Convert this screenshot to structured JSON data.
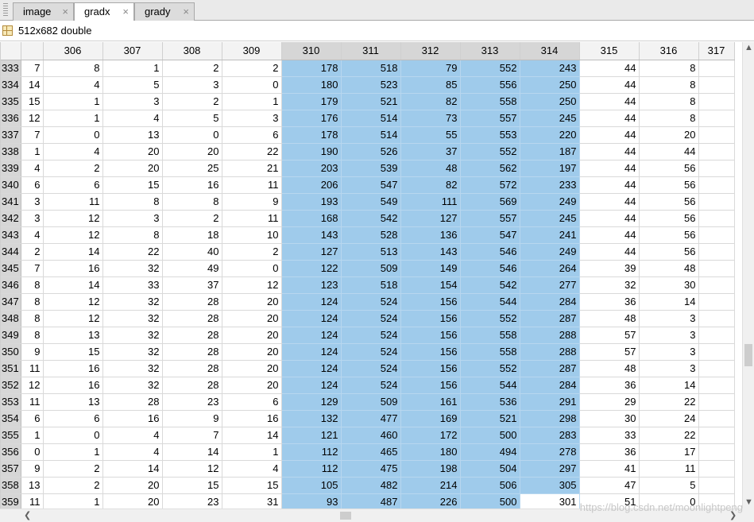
{
  "tabs": [
    {
      "label": "image",
      "active": false
    },
    {
      "label": "gradx",
      "active": true
    },
    {
      "label": "grady",
      "active": false
    }
  ],
  "variable": {
    "size_label": "512x682 double"
  },
  "grid": {
    "columns": [
      "",
      "306",
      "307",
      "308",
      "309",
      "310",
      "311",
      "312",
      "313",
      "314",
      "315",
      "316",
      "317"
    ],
    "selected_columns": [
      "310",
      "311",
      "312",
      "313",
      "314"
    ],
    "rows": [
      {
        "index": "333",
        "cells": [
          "7",
          "8",
          "1",
          "2",
          "2",
          "178",
          "518",
          "79",
          "552",
          "243",
          "44",
          "8"
        ]
      },
      {
        "index": "334",
        "cells": [
          "14",
          "4",
          "5",
          "3",
          "0",
          "180",
          "523",
          "85",
          "556",
          "250",
          "44",
          "8"
        ]
      },
      {
        "index": "335",
        "cells": [
          "15",
          "1",
          "3",
          "2",
          "1",
          "179",
          "521",
          "82",
          "558",
          "250",
          "44",
          "8"
        ]
      },
      {
        "index": "336",
        "cells": [
          "12",
          "1",
          "4",
          "5",
          "3",
          "176",
          "514",
          "73",
          "557",
          "245",
          "44",
          "8"
        ]
      },
      {
        "index": "337",
        "cells": [
          "7",
          "0",
          "13",
          "0",
          "6",
          "178",
          "514",
          "55",
          "553",
          "220",
          "44",
          "20"
        ]
      },
      {
        "index": "338",
        "cells": [
          "1",
          "4",
          "20",
          "20",
          "22",
          "190",
          "526",
          "37",
          "552",
          "187",
          "44",
          "44"
        ]
      },
      {
        "index": "339",
        "cells": [
          "4",
          "2",
          "20",
          "25",
          "21",
          "203",
          "539",
          "48",
          "562",
          "197",
          "44",
          "56"
        ]
      },
      {
        "index": "340",
        "cells": [
          "6",
          "6",
          "15",
          "16",
          "11",
          "206",
          "547",
          "82",
          "572",
          "233",
          "44",
          "56"
        ]
      },
      {
        "index": "341",
        "cells": [
          "3",
          "11",
          "8",
          "8",
          "9",
          "193",
          "549",
          "111",
          "569",
          "249",
          "44",
          "56"
        ]
      },
      {
        "index": "342",
        "cells": [
          "3",
          "12",
          "3",
          "2",
          "11",
          "168",
          "542",
          "127",
          "557",
          "245",
          "44",
          "56"
        ]
      },
      {
        "index": "343",
        "cells": [
          "4",
          "12",
          "8",
          "18",
          "10",
          "143",
          "528",
          "136",
          "547",
          "241",
          "44",
          "56"
        ]
      },
      {
        "index": "344",
        "cells": [
          "2",
          "14",
          "22",
          "40",
          "2",
          "127",
          "513",
          "143",
          "546",
          "249",
          "44",
          "56"
        ]
      },
      {
        "index": "345",
        "cells": [
          "7",
          "16",
          "32",
          "49",
          "0",
          "122",
          "509",
          "149",
          "546",
          "264",
          "39",
          "48"
        ]
      },
      {
        "index": "346",
        "cells": [
          "8",
          "14",
          "33",
          "37",
          "12",
          "123",
          "518",
          "154",
          "542",
          "277",
          "32",
          "30"
        ]
      },
      {
        "index": "347",
        "cells": [
          "8",
          "12",
          "32",
          "28",
          "20",
          "124",
          "524",
          "156",
          "544",
          "284",
          "36",
          "14"
        ]
      },
      {
        "index": "348",
        "cells": [
          "8",
          "12",
          "32",
          "28",
          "20",
          "124",
          "524",
          "156",
          "552",
          "287",
          "48",
          "3"
        ]
      },
      {
        "index": "349",
        "cells": [
          "8",
          "13",
          "32",
          "28",
          "20",
          "124",
          "524",
          "156",
          "558",
          "288",
          "57",
          "3"
        ]
      },
      {
        "index": "350",
        "cells": [
          "9",
          "15",
          "32",
          "28",
          "20",
          "124",
          "524",
          "156",
          "558",
          "288",
          "57",
          "3"
        ]
      },
      {
        "index": "351",
        "cells": [
          "11",
          "16",
          "32",
          "28",
          "20",
          "124",
          "524",
          "156",
          "552",
          "287",
          "48",
          "3"
        ]
      },
      {
        "index": "352",
        "cells": [
          "12",
          "16",
          "32",
          "28",
          "20",
          "124",
          "524",
          "156",
          "544",
          "284",
          "36",
          "14"
        ]
      },
      {
        "index": "353",
        "cells": [
          "11",
          "13",
          "28",
          "23",
          "6",
          "129",
          "509",
          "161",
          "536",
          "291",
          "29",
          "22"
        ]
      },
      {
        "index": "354",
        "cells": [
          "6",
          "6",
          "16",
          "9",
          "16",
          "132",
          "477",
          "169",
          "521",
          "298",
          "30",
          "24"
        ]
      },
      {
        "index": "355",
        "cells": [
          "1",
          "0",
          "4",
          "7",
          "14",
          "121",
          "460",
          "172",
          "500",
          "283",
          "33",
          "22"
        ]
      },
      {
        "index": "356",
        "cells": [
          "0",
          "1",
          "4",
          "14",
          "1",
          "112",
          "465",
          "180",
          "494",
          "278",
          "36",
          "17"
        ]
      },
      {
        "index": "357",
        "cells": [
          "9",
          "2",
          "14",
          "12",
          "4",
          "112",
          "475",
          "198",
          "504",
          "297",
          "41",
          "11"
        ]
      },
      {
        "index": "358",
        "cells": [
          "13",
          "2",
          "20",
          "15",
          "15",
          "105",
          "482",
          "214",
          "506",
          "305",
          "47",
          "5"
        ]
      },
      {
        "index": "359",
        "cells": [
          "11",
          "1",
          "20",
          "23",
          "31",
          "93",
          "487",
          "226",
          "500",
          "301",
          "51",
          "0"
        ]
      }
    ]
  },
  "watermark": "https://blog.csdn.net/moonlightpeng",
  "icons": {
    "close": "×",
    "scroll_up": "▲",
    "scroll_down": "▼",
    "scroll_left": "❮",
    "scroll_right": "❯"
  }
}
